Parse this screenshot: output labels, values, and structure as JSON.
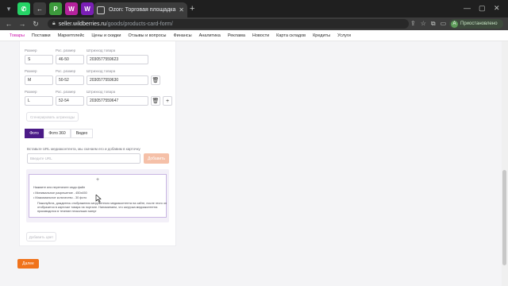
{
  "browser": {
    "pinned_tabs": [
      {
        "icon": "whatsapp-icon",
        "glyph": "✆",
        "color": "#25d366"
      },
      {
        "icon": "back-tab-icon",
        "glyph": "←",
        "color": "#3c3c3c"
      },
      {
        "icon": "green-p-icon",
        "glyph": "P",
        "color": "#3c9a3c"
      },
      {
        "icon": "wb-icon",
        "glyph": "W",
        "color": "#b5229c"
      },
      {
        "icon": "wb-purple-icon",
        "glyph": "W",
        "color": "#7a1fb5"
      },
      {
        "icon": "wb-magenta-icon",
        "glyph": "W",
        "color": "#cb11ab"
      }
    ],
    "active_tab_title": "Ozon: Торговая площадка",
    "url_host": "seller.wildberries.ru",
    "url_path": "/goods/products-card-form/",
    "profile_initial": "А",
    "profile_label": "Приостановлено"
  },
  "site_nav": {
    "items": [
      "Товары",
      "Поставки",
      "Маркетплейс",
      "Цены и скидки",
      "Отзывы и вопросы",
      "Финансы",
      "Аналитика",
      "Реклама",
      "Новости",
      "Карта складов",
      "Кредиты",
      "Услуги"
    ]
  },
  "form": {
    "rows": [
      {
        "size_label": "Размер",
        "size": "S",
        "ros_label": "Рос. размер",
        "ros": "46-50",
        "barcode_label": "Штрихкод товара",
        "barcode": "2030577559623"
      },
      {
        "size_label": "Размер",
        "size": "M",
        "ros_label": "Рос. размер",
        "ros": "50-52",
        "barcode_label": "Штрихкод товара",
        "barcode": "2030577559630"
      },
      {
        "size_label": "Размер",
        "size": "L",
        "ros_label": "Рос. размер",
        "ros": "52-54",
        "barcode_label": "Штрихкод товара",
        "barcode": "2030577559647"
      }
    ],
    "generate_barcodes": "Сгенерировать штрихкоды",
    "media_tabs": [
      "Фото",
      "Фото 360",
      "Видео"
    ],
    "url_hint": "Вставьте URL медиаконтента, мы скачаем его и добавим в карточку",
    "url_placeholder": "Введите URL",
    "add_button": "Добавить",
    "dropzone": {
      "plus": "+",
      "title": "Нажмите или перетяните сюда файл",
      "bullet1": "• Минимальное разрешение - 450x450",
      "bullet2": "• Максимальное количество - 30 фото",
      "note1": "Пожалуйста, дождитесь отображения загруженного медиаконтента на сайте, после этого он",
      "note2": "отобразится в карточке товара на портале. Напоминаем, что загрузка медиаконтента",
      "note3": "производится в течение нескольких минут"
    },
    "add_color": "Добавить цвет",
    "save": "Далее"
  }
}
